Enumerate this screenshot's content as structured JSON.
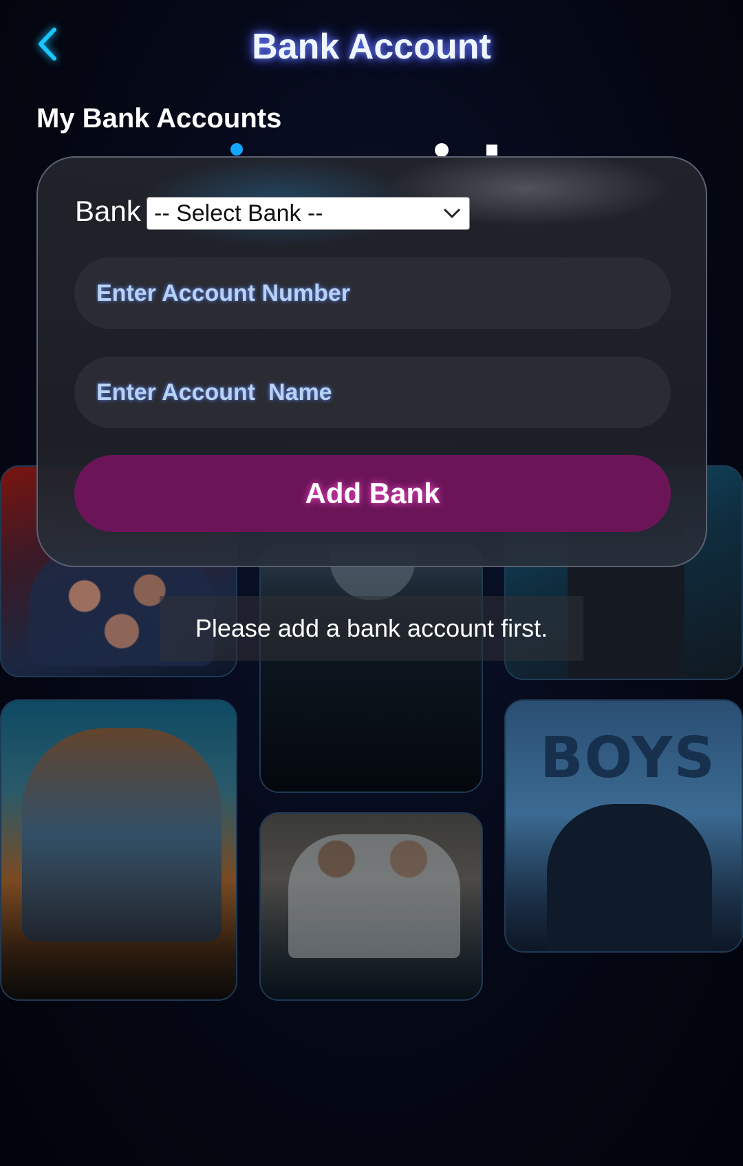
{
  "header": {
    "title": "Bank Account",
    "back_icon": "chevron-left-icon"
  },
  "section": {
    "title": "My Bank Accounts"
  },
  "posters": {
    "p6_title": "BOYS"
  },
  "form": {
    "bank_label": "Bank",
    "bank_select": {
      "selected": "-- Select Bank --",
      "icon": "chevron-down-icon"
    },
    "account_number": {
      "value": "",
      "placeholder": "Enter Account Number"
    },
    "account_name": {
      "value": "",
      "placeholder": "Enter Account  Name"
    },
    "submit_label": "Add Bank"
  },
  "toast": {
    "message": "Please add a bank account first."
  },
  "colors": {
    "accent_cyan": "#19c6ff",
    "button_purple": "#6b1558",
    "background": "#050816"
  }
}
